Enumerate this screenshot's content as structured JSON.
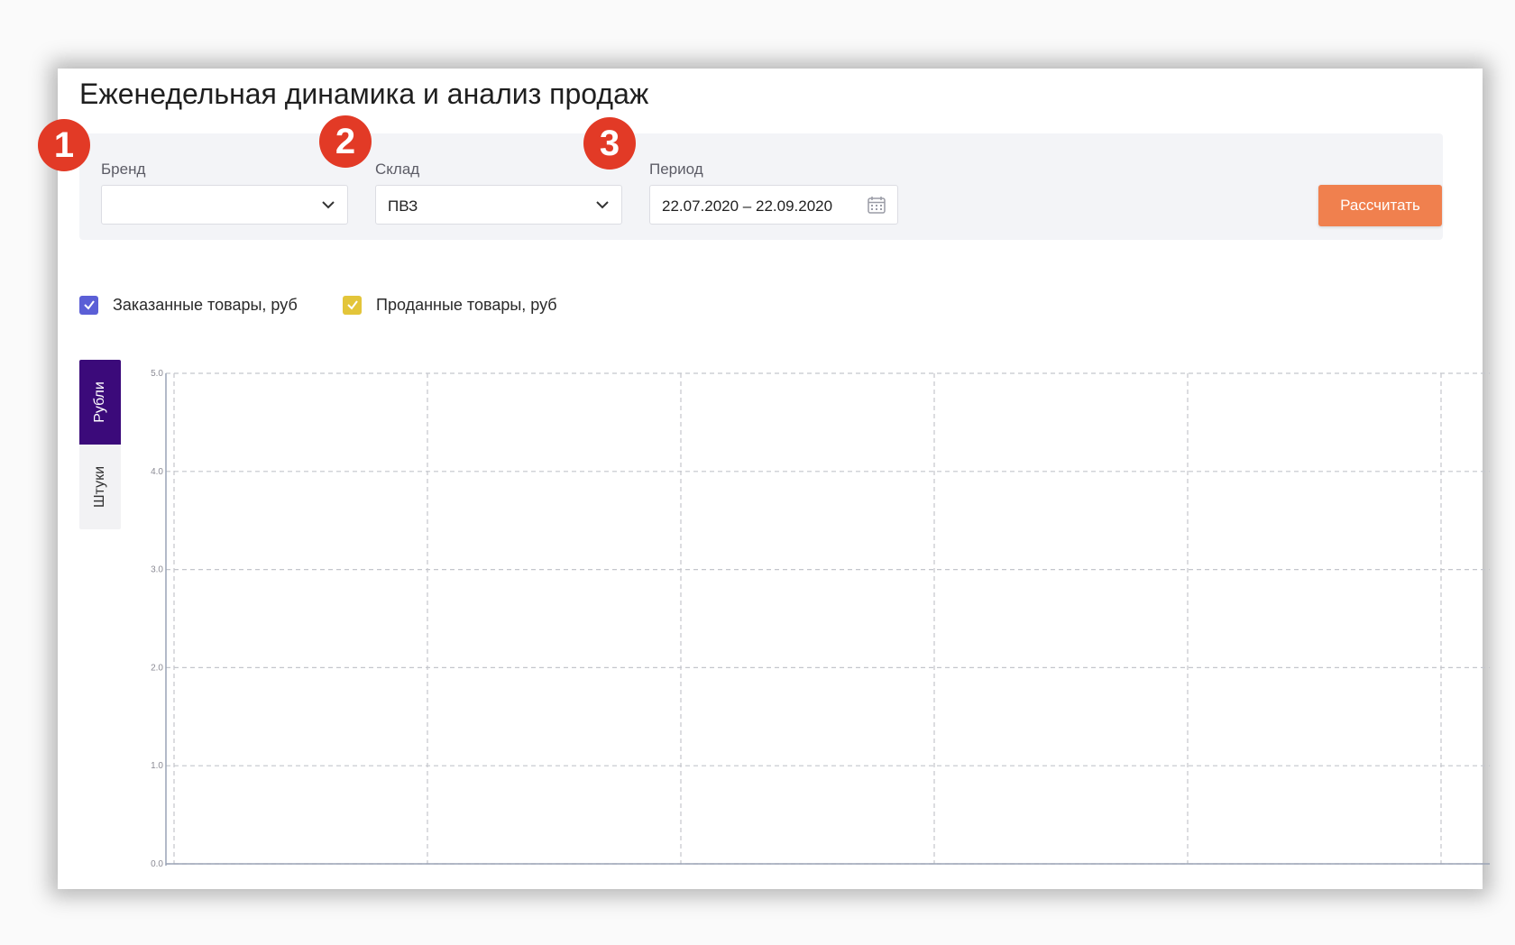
{
  "header": {
    "title": "Еженедельная динамика и анализ продаж"
  },
  "badges": [
    "1",
    "2",
    "3"
  ],
  "filters": {
    "brand": {
      "label": "Бренд",
      "value": ""
    },
    "warehouse": {
      "label": "Склад",
      "value": "ПВЗ"
    },
    "period": {
      "label": "Период",
      "value": "22.07.2020 – 22.09.2020"
    },
    "calculate_label": "Рассчитать"
  },
  "legend": [
    {
      "label": "Заказанные товары, руб",
      "checked": true,
      "color": "#5b5fd6"
    },
    {
      "label": "Проданные товары, руб",
      "checked": true,
      "color": "#e3c53a"
    }
  ],
  "unit_tabs": [
    {
      "label": "Рубли",
      "active": true
    },
    {
      "label": "Штуки",
      "active": false
    }
  ],
  "colors": {
    "accent_button": "#f0804e",
    "active_tab": "#3b0a7a",
    "badge": "#e23a26"
  },
  "chart_data": {
    "type": "line",
    "y_ticks": [
      "0.0",
      "1.0",
      "2.0",
      "3.0",
      "4.0",
      "5.0"
    ],
    "ylim": [
      0,
      5
    ],
    "x_gridlines": 6,
    "series": [],
    "grid": true
  }
}
